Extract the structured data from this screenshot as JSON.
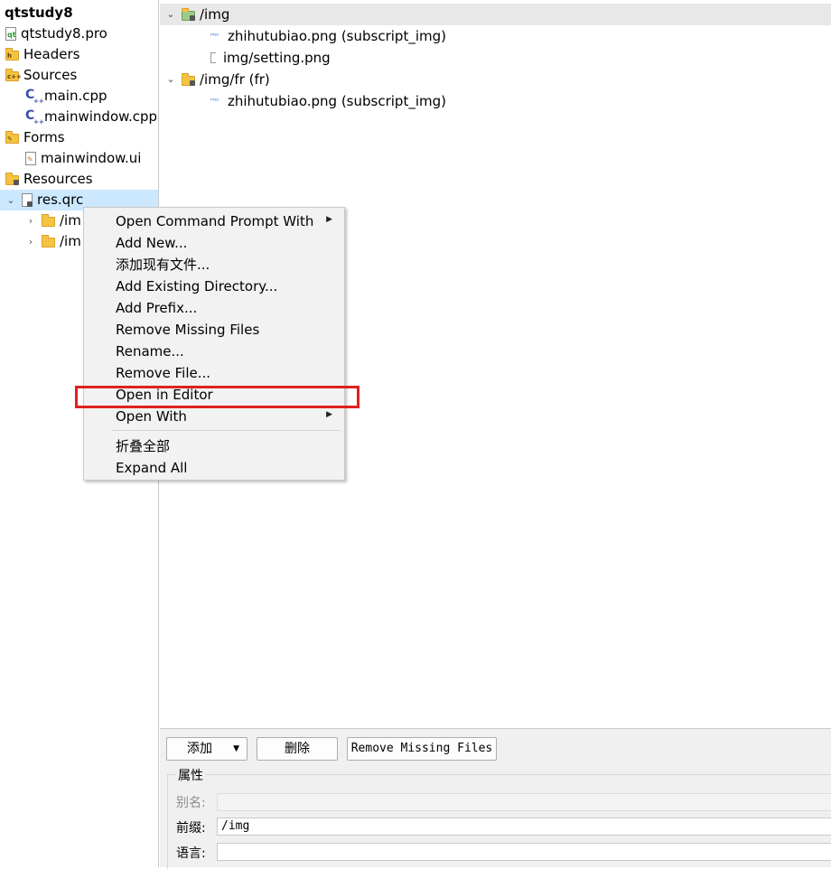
{
  "project_tree": {
    "root": "qtstudy8",
    "items": [
      {
        "label": "qtstudy8.pro",
        "icon": "pro-file-icon"
      },
      {
        "label": "Headers",
        "icon": "headers-folder-icon",
        "badge": "h"
      },
      {
        "label": "Sources",
        "icon": "sources-folder-icon",
        "badge": "c++"
      },
      {
        "label": "main.cpp",
        "icon": "cpp-file-icon"
      },
      {
        "label": "mainwindow.cpp",
        "icon": "cpp-file-icon"
      },
      {
        "label": "Forms",
        "icon": "forms-folder-icon"
      },
      {
        "label": "mainwindow.ui",
        "icon": "ui-file-icon"
      },
      {
        "label": "Resources",
        "icon": "resources-folder-icon"
      },
      {
        "label": "res.qrc",
        "icon": "qrc-file-icon"
      },
      {
        "label": "/im",
        "icon": "folder-icon"
      },
      {
        "label": "/im",
        "icon": "folder-icon"
      }
    ]
  },
  "resource_tree": {
    "items": [
      {
        "label": "/img"
      },
      {
        "label": "zhihutubiao.png (subscript_img)"
      },
      {
        "label": "img/setting.png"
      },
      {
        "label": "/img/fr (fr)"
      },
      {
        "label": "zhihutubiao.png (subscript_img)"
      }
    ],
    "file_tag": "ᴾᴺᴳ"
  },
  "context_menu": {
    "items": [
      "Open Command Prompt With",
      "Add New...",
      "添加现有文件...",
      "Add Existing Directory...",
      "Add Prefix...",
      "Remove Missing Files",
      "Rename...",
      "Remove File...",
      "Open in Editor",
      "Open With",
      "折叠全部",
      "Expand All"
    ],
    "highlight_color": "#e02020"
  },
  "bottom_panel": {
    "add_button": "添加",
    "delete_button": "删除",
    "remove_missing_button": "Remove Missing Files",
    "group_title": "属性",
    "alias_label": "别名:",
    "alias_value": "",
    "prefix_label": "前缀:",
    "prefix_value": "/img",
    "language_label": "语言:",
    "language_value": ""
  }
}
